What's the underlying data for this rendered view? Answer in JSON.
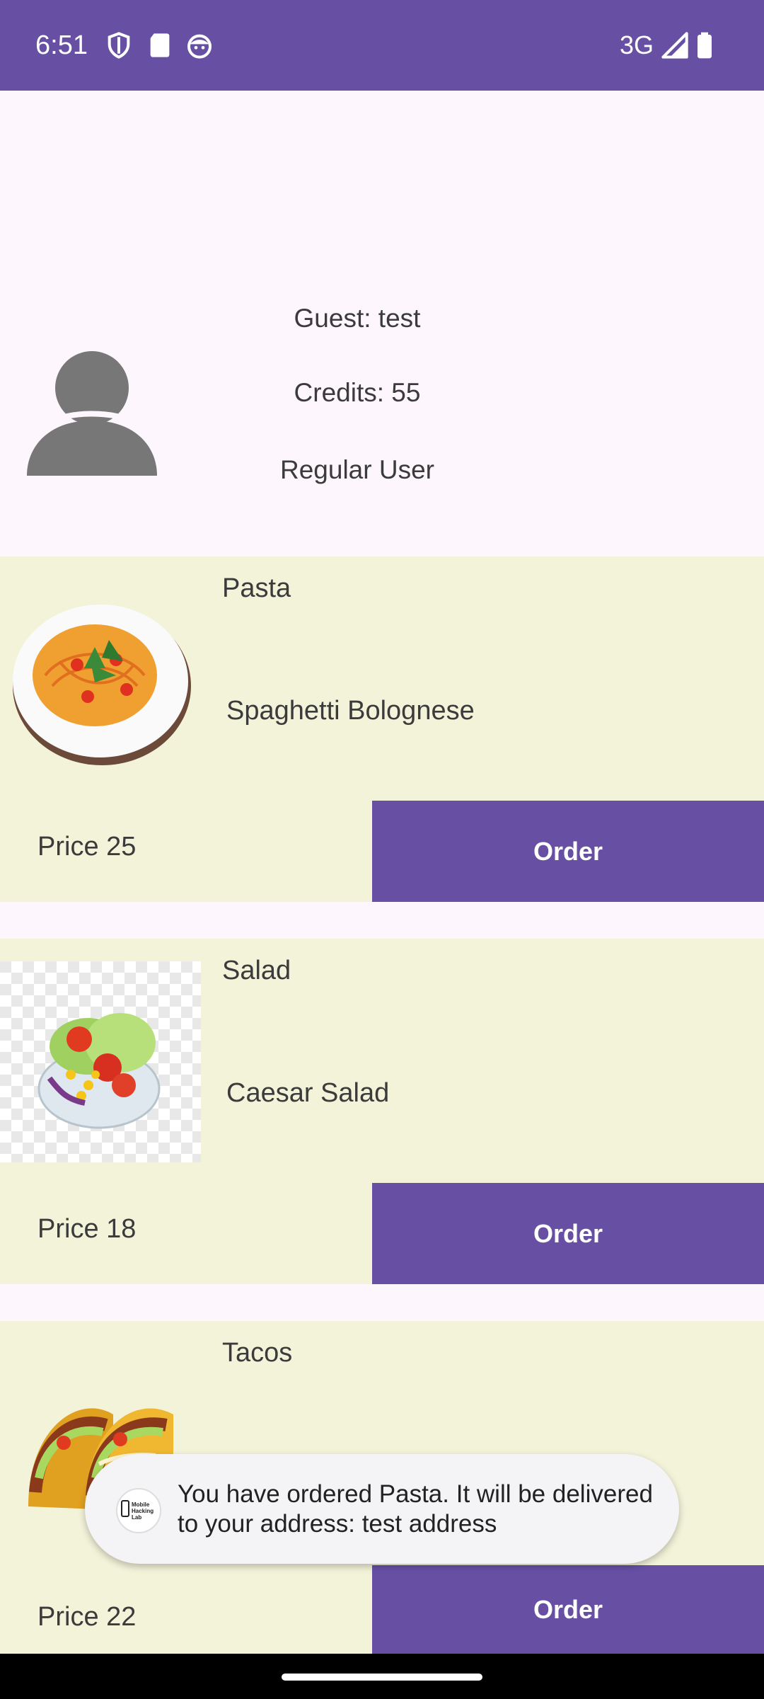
{
  "status_bar": {
    "time": "6:51",
    "network": "3G",
    "icons": [
      "shield-icon",
      "sd-card-icon",
      "face-icon",
      "signal-icon",
      "battery-icon"
    ]
  },
  "profile": {
    "guest": "Guest: test",
    "credits": "Credits: 55",
    "role": "Regular User",
    "avatar_icon": "person-icon"
  },
  "menu": [
    {
      "name": "Pasta",
      "description": "Spaghetti Bolognese",
      "price": "Price 25",
      "order_label": "Order",
      "image": "pasta-image"
    },
    {
      "name": "Salad",
      "description": "Caesar Salad",
      "price": "Price 18",
      "order_label": "Order",
      "image": "salad-image"
    },
    {
      "name": "Tacos",
      "description": "",
      "price": "Price 22",
      "order_label": "Order",
      "image": "tacos-image"
    }
  ],
  "toast": {
    "message": "You have ordered Pasta. It will be delivered to your address: test address",
    "logo_text": "Mobile Hacking Lab"
  },
  "colors": {
    "accent": "#6750a4",
    "card_bg": "#f3f3da",
    "page_bg": "#fdf6fd"
  }
}
